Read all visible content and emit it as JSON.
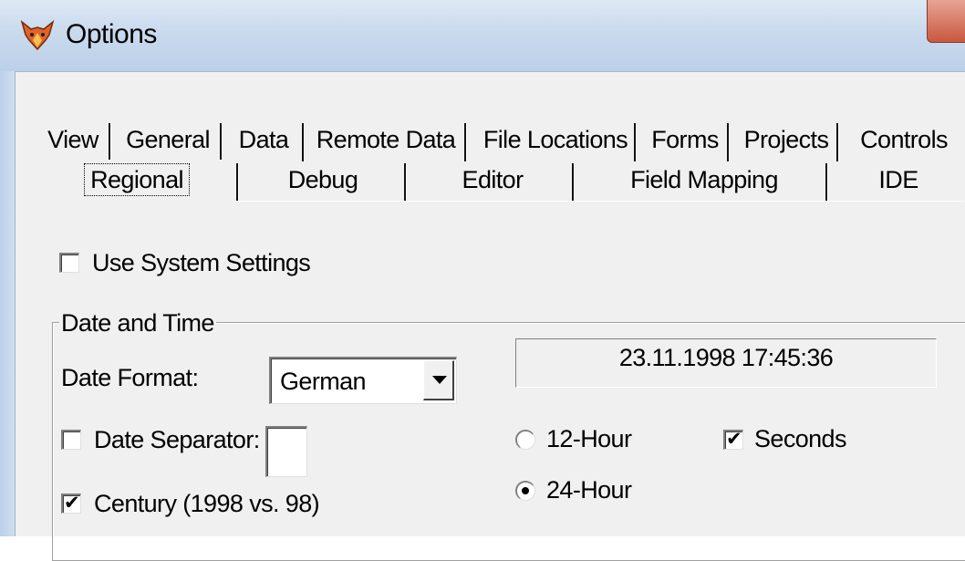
{
  "window": {
    "title": "Options",
    "app_icon": "fox-icon"
  },
  "tabs_row1": [
    "View",
    "General",
    "Data",
    "Remote Data",
    "File Locations",
    "Forms",
    "Projects",
    "Controls"
  ],
  "tabs_row2": [
    "Regional",
    "Debug",
    "Editor",
    "Field Mapping",
    "IDE"
  ],
  "active_tab": "Regional",
  "use_system_settings": {
    "label": "Use System Settings",
    "checked": false
  },
  "date_time_group": {
    "title": "Date and Time",
    "date_format": {
      "label": "Date Format:",
      "value": "German"
    },
    "date_separator": {
      "label": "Date Separator:",
      "checked": false,
      "value": ""
    },
    "century": {
      "label": "Century (1998 vs. 98)",
      "checked": true
    },
    "preview": "23.11.1998 17:45:36",
    "hour_12": {
      "label": "12-Hour",
      "selected": false
    },
    "hour_24": {
      "label": "24-Hour",
      "selected": true
    },
    "seconds": {
      "label": "Seconds",
      "checked": true
    }
  }
}
